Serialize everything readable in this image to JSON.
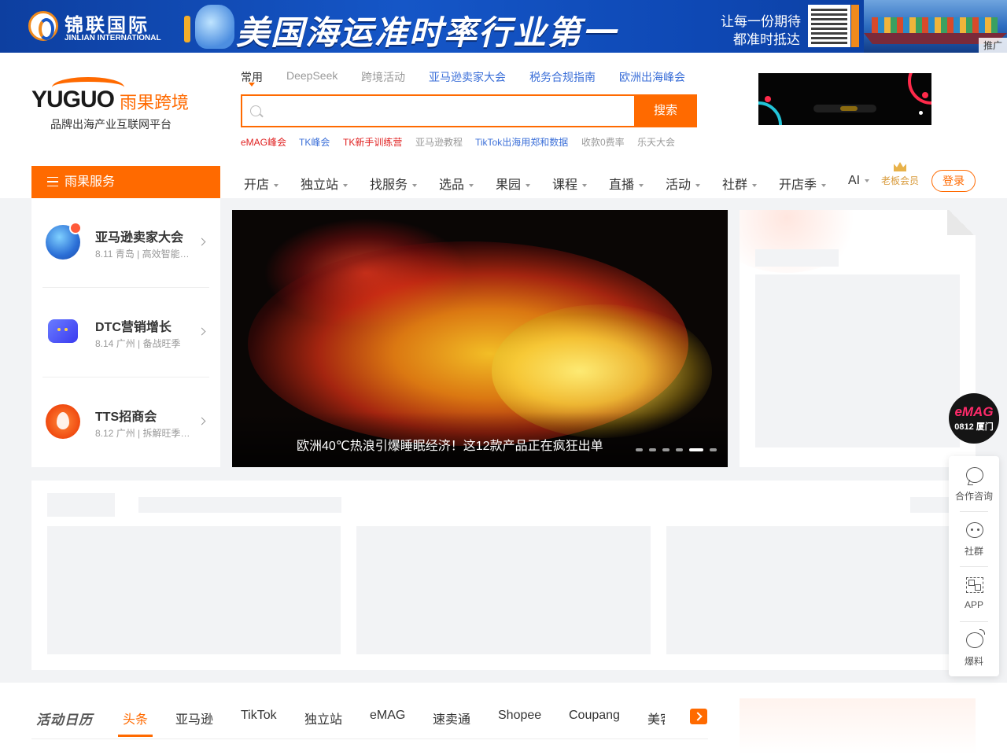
{
  "banner": {
    "brand_cn": "锦联国际",
    "brand_en": "JINLIAN INTERNATIONAL",
    "headline": "美国海运准时率行业第一",
    "slogan_line1": "让每一份期待",
    "slogan_line2": "都准时抵达",
    "ad_tag": "推广"
  },
  "logo": {
    "en": "YUGUO",
    "cn": "雨果跨境",
    "tagline": "品牌出海产业互联网平台"
  },
  "search": {
    "tabs": [
      "常用",
      "DeepSeek",
      "跨境活动",
      "亚马逊卖家大会",
      "税务合规指南",
      "欧洲出海峰会"
    ],
    "placeholder": "",
    "button_label": "搜索",
    "hot_words": [
      "eMAG峰会",
      "TK峰会",
      "TK新手训练营",
      "亚马逊教程",
      "TikTok出海用郑和数据",
      "收款0费率",
      "乐天大会"
    ]
  },
  "nav": {
    "service_label": "雨果服务",
    "items": [
      "开店",
      "独立站",
      "找服务",
      "选品",
      "果园",
      "课程",
      "直播",
      "活动",
      "社群",
      "开店季",
      "AI"
    ],
    "vip_label": "老板会员",
    "login_label": "登录"
  },
  "events": [
    {
      "title": "亚马逊卖家大会",
      "subtitle": "8.11 青岛 | 高效智能…",
      "icon": "globe-icon"
    },
    {
      "title": "DTC营销增长",
      "subtitle": "8.14 广州 | 备战旺季",
      "icon": "screen-icon"
    },
    {
      "title": "TTS招商会",
      "subtitle": "8.12 广州 | 拆解旺季…",
      "icon": "fire-icon"
    }
  ],
  "hero": {
    "caption": "欧洲40℃热浪引爆睡眠经济！这12款产品正在疯狂出单",
    "slide_count": 6,
    "active_slide": 5
  },
  "bottom_tabs": {
    "calendar_label": "活动日历",
    "items": [
      "头条",
      "亚马逊",
      "TikTok",
      "独立站",
      "eMAG",
      "速卖通",
      "Shopee",
      "Coupang",
      "美客"
    ],
    "active_index": 0
  },
  "floating": {
    "emag_line1": "eMAG",
    "emag_line2": "0812 厦门",
    "items": [
      {
        "label": "合作咨询",
        "icon": "chat-icon"
      },
      {
        "label": "社群",
        "icon": "wechat-icon"
      },
      {
        "label": "APP",
        "icon": "qr-code-icon"
      },
      {
        "label": "爆料",
        "icon": "bomb-icon"
      }
    ]
  },
  "colors": {
    "accent": "#ff6a00",
    "link_blue": "#3b6fd8",
    "hot_red": "#e02020",
    "banner_blue": "#1556c7"
  }
}
